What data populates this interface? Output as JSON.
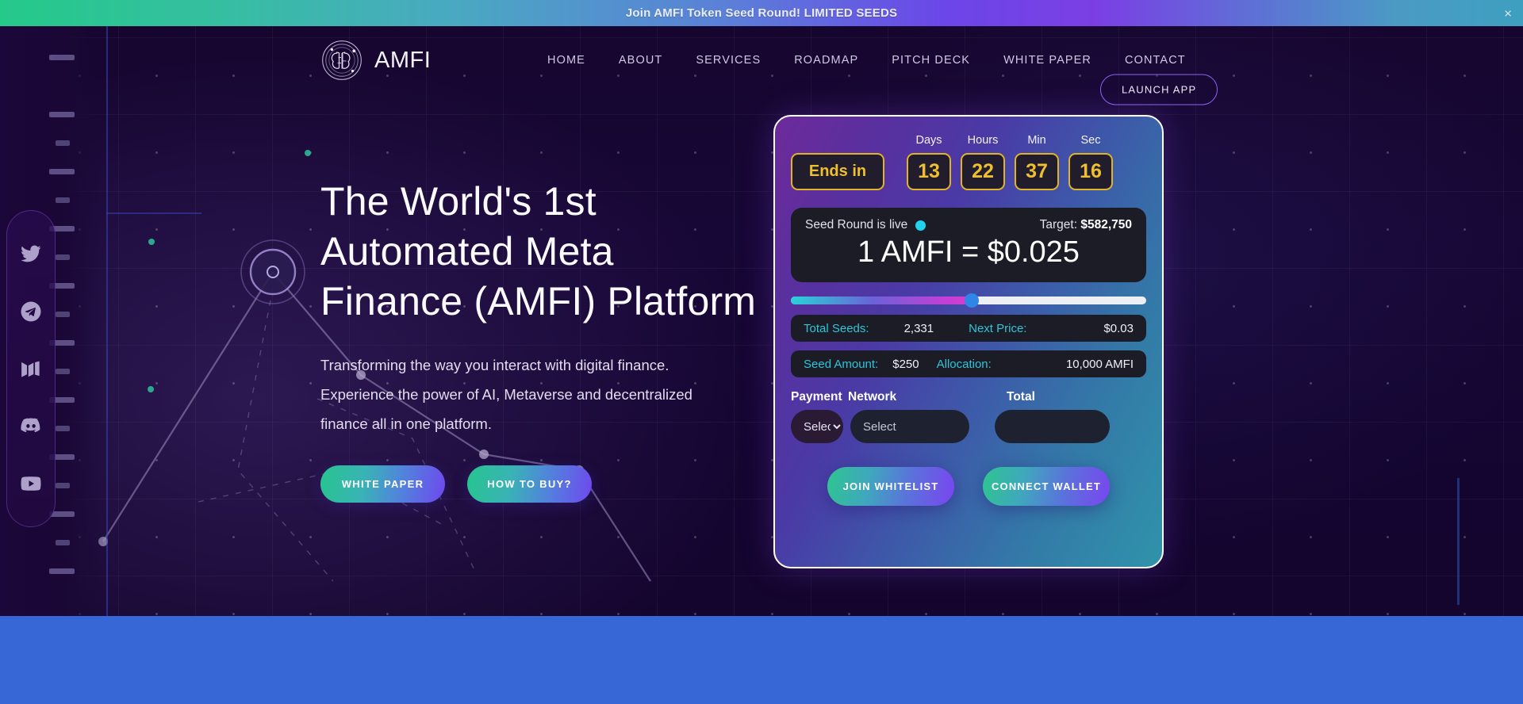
{
  "banner": {
    "text": "Join AMFI Token Seed Round! LIMITED SEEDS",
    "close_label": "×",
    "gradient_start": "#25c98a",
    "gradient_end": "#3e9fc0"
  },
  "header": {
    "logo_text": "AMFI",
    "logo_icon": "amfi-brain-logo",
    "nav": [
      {
        "label": "HOME"
      },
      {
        "label": "ABOUT"
      },
      {
        "label": "SERVICES"
      },
      {
        "label": "ROADMAP"
      },
      {
        "label": "PITCH DECK"
      },
      {
        "label": "WHITE PAPER"
      },
      {
        "label": "CONTACT"
      }
    ],
    "launch_label": "LAUNCH APP",
    "launch_border_color": "#8e62f7"
  },
  "hero": {
    "title": "The World's 1st Automated Meta Finance (AMFI) Platform",
    "subtitle": "Transforming the way you interact with digital finance. Experience the power of AI, Metaverse and decentralized finance all in one platform.",
    "cta": [
      {
        "label": "WHITE PAPER"
      },
      {
        "label": "HOW TO BUY?"
      }
    ]
  },
  "social": [
    {
      "name": "twitter-icon"
    },
    {
      "name": "telegram-icon"
    },
    {
      "name": "medium-icon"
    },
    {
      "name": "discord-icon"
    },
    {
      "name": "youtube-icon"
    }
  ],
  "sale_card": {
    "ends_in_label": "Ends in",
    "countdown": [
      {
        "label": "Days",
        "value": "13"
      },
      {
        "label": "Hours",
        "value": "22"
      },
      {
        "label": "Min",
        "value": "37"
      },
      {
        "label": "Sec",
        "value": "16"
      }
    ],
    "status_text": "Seed Round is live",
    "status_dot_color": "#22d3ee",
    "target_label": "Target:",
    "target_value": "$582,750",
    "price_line": "1 AMFI = $0.025",
    "progress_percent": 51,
    "stats_row_1": [
      {
        "label": "Total Seeds:",
        "value": "2,331"
      },
      {
        "label": "Next Price:",
        "value": "$0.03"
      }
    ],
    "stats_row_2": [
      {
        "label": "Seed Amount:",
        "value": "$250"
      },
      {
        "label": "Allocation:",
        "value": "10,000 AMFI"
      }
    ],
    "form": {
      "payment_label": "Payment",
      "network_label": "Network",
      "total_label": "Total",
      "payment_value": "Select",
      "network_placeholder": "Select",
      "total_value": ""
    },
    "actions": [
      {
        "label": "JOIN WHITELIST"
      },
      {
        "label": "CONNECT WALLET"
      }
    ],
    "accent_gold": "#e0b429",
    "accent_cyan": "#2ec5d8"
  }
}
